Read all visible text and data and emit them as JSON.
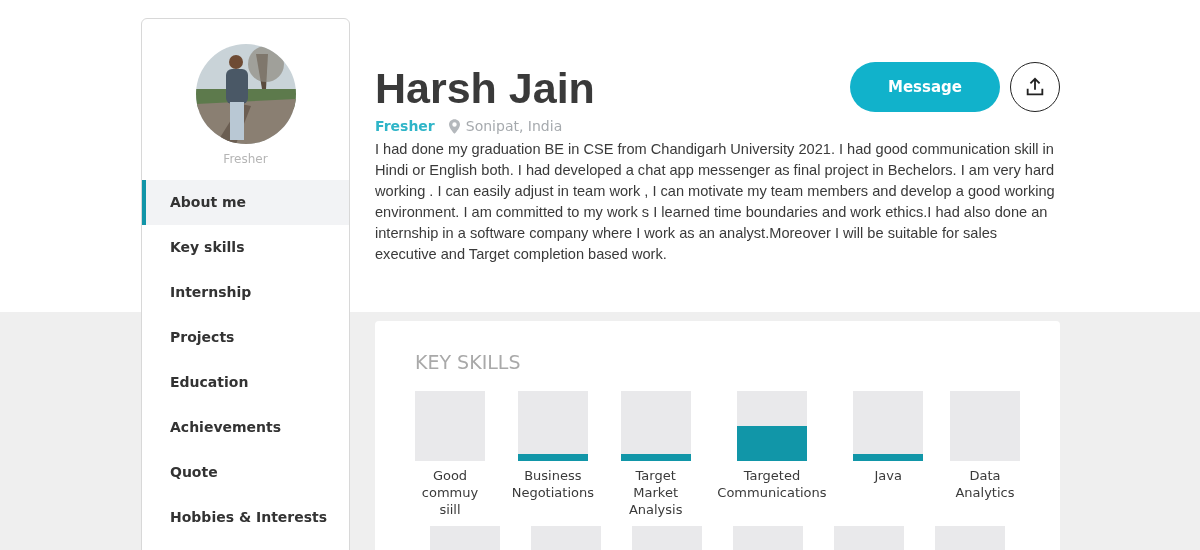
{
  "profile": {
    "caption": "Fresher"
  },
  "sidebar": {
    "items": [
      {
        "label": "About me",
        "selected": true
      },
      {
        "label": "Key skills",
        "selected": false
      },
      {
        "label": "Internship",
        "selected": false
      },
      {
        "label": "Projects",
        "selected": false
      },
      {
        "label": "Education",
        "selected": false
      },
      {
        "label": "Achievements",
        "selected": false
      },
      {
        "label": "Quote",
        "selected": false
      },
      {
        "label": "Hobbies & Interests",
        "selected": false
      }
    ]
  },
  "header": {
    "name": "Harsh Jain",
    "status": "Fresher",
    "location": "Sonipat, India",
    "message_button": "Message",
    "about": "I had done my graduation BE in CSE from Chandigarh University 2021. I had good communication skill in Hindi or English both. I had developed a chat app messenger as final project in Bechelors. I am very hard working . I can easily adjust in team work , I can motivate my team members and develop a good working environment. I am committed to my work s I learned time boundaries and work ethics.I had also done an internship in a software company where I work as an analyst.Moreover I will be suitable for sales executive and Target completion based work."
  },
  "key_skills": {
    "title": "KEY SKILLS",
    "skills": [
      {
        "label": "Good commuy siill",
        "kind": "empty"
      },
      {
        "label": "Business Negotiations",
        "kind": "low"
      },
      {
        "label": "Target Market Analysis",
        "kind": "low"
      },
      {
        "label": "Targeted Communications",
        "kind": "half"
      },
      {
        "label": "Java",
        "kind": "low"
      },
      {
        "label": "Data Analytics",
        "kind": "empty"
      }
    ]
  }
}
